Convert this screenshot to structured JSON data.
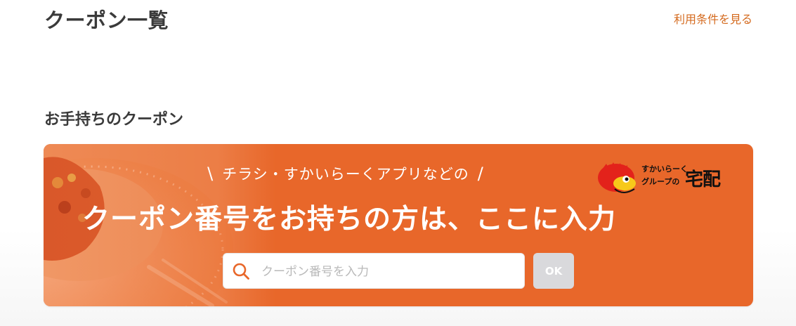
{
  "header": {
    "title": "クーポン一覧",
    "terms_link": "利用条件を見る"
  },
  "section": {
    "title": "お手持ちのクーポン"
  },
  "banner": {
    "lead": "チラシ・すかいらーくアプリなどの",
    "lead_slash_left": "\\",
    "lead_slash_right": "/",
    "headline": "クーポン番号をお持ちの方は、ここに入力",
    "logo": {
      "line1": "すかいらーく",
      "line2": "グループの",
      "main": "宅配"
    }
  },
  "search": {
    "placeholder": "クーポン番号を入力",
    "value": "",
    "ok_label": "OK",
    "icon": "search-icon"
  },
  "colors": {
    "accent": "#e8672a",
    "link": "#d46a1e",
    "button_disabled": "#d9d9dc"
  }
}
